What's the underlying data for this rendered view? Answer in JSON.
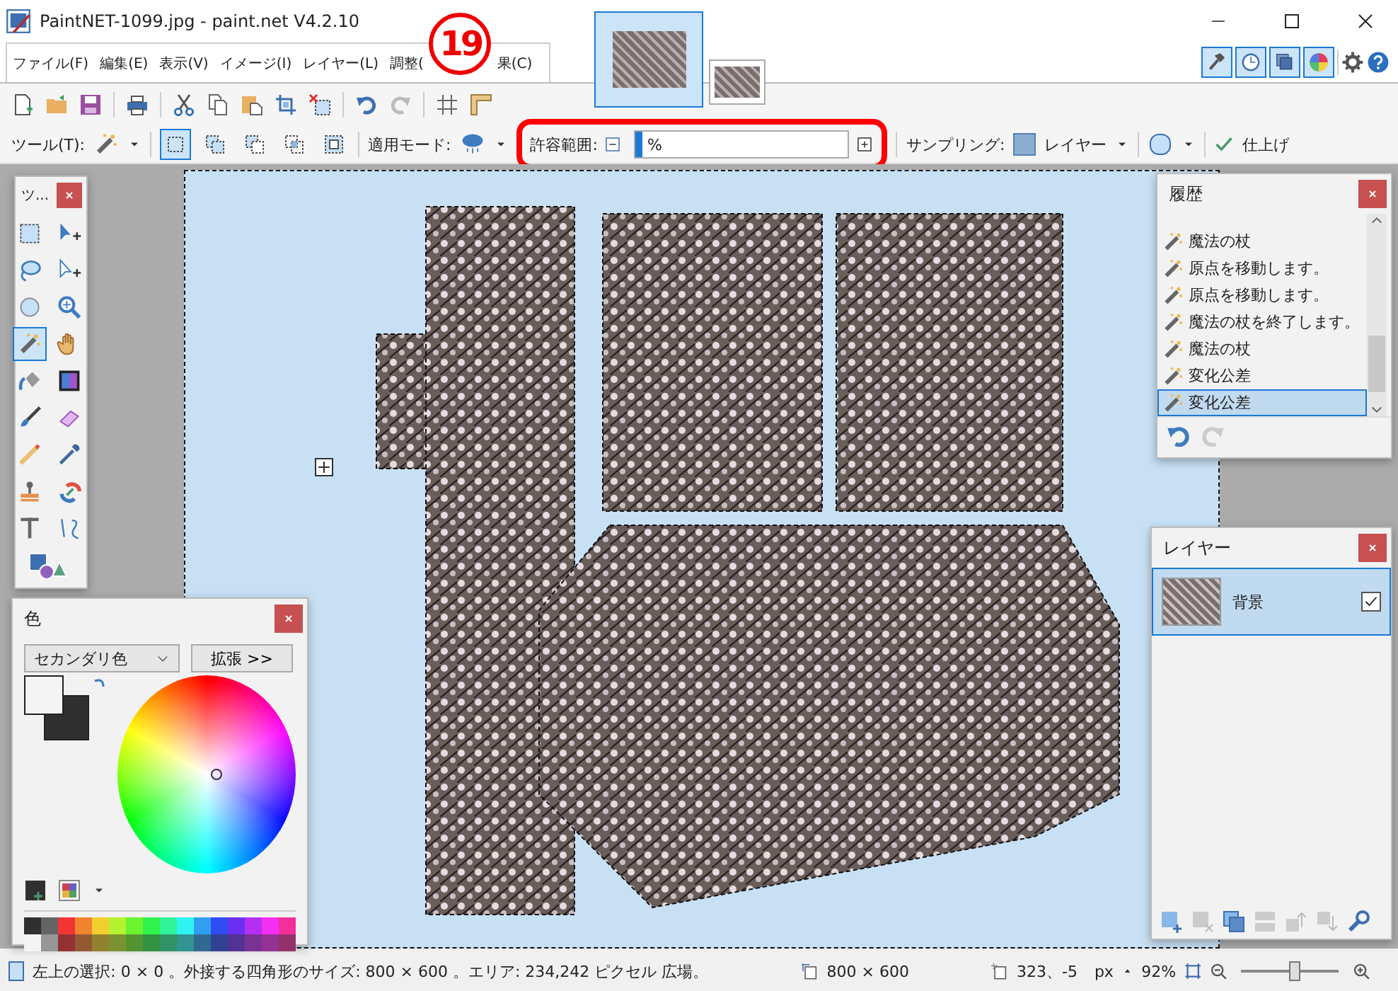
{
  "window": {
    "title": "PaintNET-1099.jpg - paint.net V4.2.10"
  },
  "menu": [
    "ファイル(F)",
    "編集(E)",
    "表示(V)",
    "イメージ(I)",
    "レイヤー(L)",
    "調整(",
    "果(C)"
  ],
  "annotation": {
    "number": "19"
  },
  "image_tabs": [
    {
      "selected": true
    },
    {
      "selected": false
    }
  ],
  "panel_toggles": [
    {
      "kind": "tools",
      "selected": true
    },
    {
      "kind": "history",
      "selected": true
    },
    {
      "kind": "layers",
      "selected": true
    },
    {
      "kind": "colors",
      "selected": true
    }
  ],
  "tool_options": {
    "tool_label": "ツール(T):",
    "selection_modes": [
      {
        "kind": "replace",
        "selected": true
      },
      {
        "kind": "union",
        "selected": false
      },
      {
        "kind": "exclude",
        "selected": false
      },
      {
        "kind": "intersect",
        "selected": false
      },
      {
        "kind": "invert",
        "selected": false
      }
    ],
    "flood_mode_label": "適用モード:",
    "tolerance": {
      "label": "許容範囲:",
      "value": "%",
      "level": 0.03
    },
    "sampling": {
      "label": "サンプリング:",
      "value": "レイヤー"
    },
    "finish": "仕上げ"
  },
  "tools_panel": {
    "title": "ツ...",
    "tools": [
      {
        "kind": "rectselect",
        "selected": false
      },
      {
        "kind": "move",
        "selected": false
      },
      {
        "kind": "lasso",
        "selected": false
      },
      {
        "kind": "movesel",
        "selected": false
      },
      {
        "kind": "ellipse",
        "selected": false
      },
      {
        "kind": "zoom",
        "selected": false
      },
      {
        "kind": "wand",
        "selected": true
      },
      {
        "kind": "pan",
        "selected": false
      },
      {
        "kind": "bucket",
        "selected": false
      },
      {
        "kind": "gradient",
        "selected": false
      },
      {
        "kind": "brush",
        "selected": false
      },
      {
        "kind": "eraser",
        "selected": false
      },
      {
        "kind": "pencil",
        "selected": false
      },
      {
        "kind": "picker",
        "selected": false
      },
      {
        "kind": "stamp",
        "selected": false
      },
      {
        "kind": "recolor",
        "selected": false
      },
      {
        "kind": "text",
        "selected": false
      },
      {
        "kind": "line",
        "selected": false
      },
      {
        "kind": "shapes",
        "selected": false
      }
    ]
  },
  "colors_panel": {
    "title": "色",
    "mode": "セカンダリ色",
    "expand_button": "拡張 >>",
    "palette": [
      {
        "color": "#303030"
      },
      {
        "color": "#646464"
      },
      {
        "color": "#f23434"
      },
      {
        "color": "#f2832f"
      },
      {
        "color": "#f2cf2f"
      },
      {
        "color": "#b5f22f"
      },
      {
        "color": "#6cf22f"
      },
      {
        "color": "#2ff24b"
      },
      {
        "color": "#2ff29b"
      },
      {
        "color": "#2ff2f2"
      },
      {
        "color": "#2f9ff2"
      },
      {
        "color": "#2f4bf2"
      },
      {
        "color": "#6c2ff2"
      },
      {
        "color": "#b52ff2"
      },
      {
        "color": "#f22ff2"
      },
      {
        "color": "#f22f9b"
      },
      {
        "color": "#f4f4f4"
      },
      {
        "color": "#969696"
      },
      {
        "color": "#933232"
      },
      {
        "color": "#935a32"
      },
      {
        "color": "#938132"
      },
      {
        "color": "#7a9332"
      },
      {
        "color": "#529332"
      },
      {
        "color": "#329341"
      },
      {
        "color": "#329369"
      },
      {
        "color": "#329393"
      },
      {
        "color": "#326993"
      },
      {
        "color": "#324193"
      },
      {
        "color": "#523293"
      },
      {
        "color": "#7a3293"
      },
      {
        "color": "#933293"
      },
      {
        "color": "#933269"
      }
    ]
  },
  "history_panel": {
    "title": "履歴",
    "items": [
      {
        "label": "魔法の杖",
        "selected": false
      },
      {
        "label": "原点を移動します。",
        "selected": false
      },
      {
        "label": "原点を移動します。",
        "selected": false
      },
      {
        "label": "魔法の杖を終了します。",
        "selected": false
      },
      {
        "label": "魔法の杖",
        "selected": false
      },
      {
        "label": "変化公差",
        "selected": false
      },
      {
        "label": "変化公差",
        "selected": true
      }
    ],
    "undo": {
      "disabled": false
    },
    "redo": {
      "disabled": true
    }
  },
  "layers_panel": {
    "title": "レイヤー",
    "layers": [
      {
        "name": "背景",
        "visible": true,
        "selected": true
      }
    ]
  },
  "status_bar": {
    "selection_info": "左上の選択: 0 × 0 。外接する四角形のサイズ: 800 × 600 。エリア: 234,242 ピクセル 広場。",
    "image_size": "800 × 600",
    "cursor_position": "323、-5",
    "units": "px",
    "zoom": "92%",
    "zoom_slider": {
      "level": 0.55
    }
  }
}
